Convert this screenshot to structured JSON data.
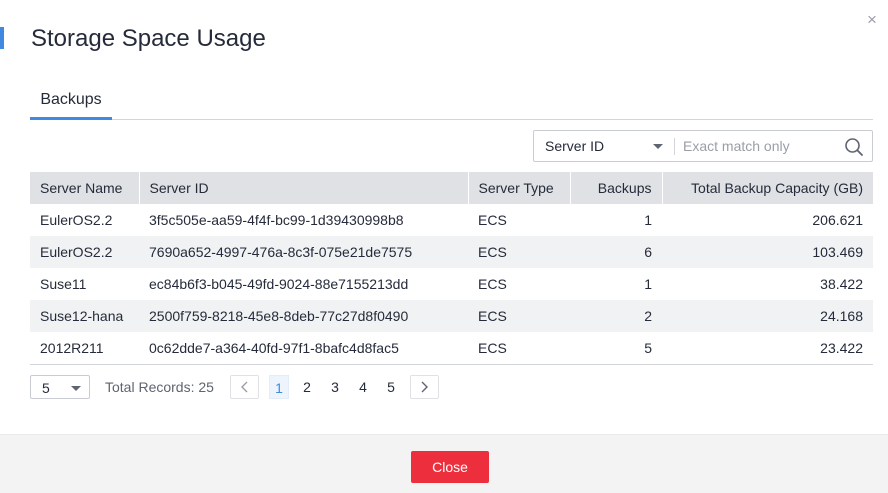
{
  "dialog": {
    "title": "Storage Space Usage",
    "close_glyph": "×"
  },
  "tabs": [
    {
      "label": "Backups",
      "active": true
    }
  ],
  "filter": {
    "field": "Server ID",
    "placeholder": "Exact match only",
    "value": ""
  },
  "table": {
    "columns": [
      "Server Name",
      "Server ID",
      "Server Type",
      "Backups",
      "Total Backup Capacity (GB)"
    ],
    "rows": [
      [
        "EulerOS2.2",
        "3f5c505e-aa59-4f4f-bc99-1d39430998b8",
        "ECS",
        "1",
        "206.621"
      ],
      [
        "EulerOS2.2",
        "7690a652-4997-476a-8c3f-075e21de7575",
        "ECS",
        "6",
        "103.469"
      ],
      [
        "Suse11",
        "ec84b6f3-b045-49fd-9024-88e7155213dd",
        "ECS",
        "1",
        "38.422"
      ],
      [
        "Suse12-hana",
        "2500f759-8218-45e8-8deb-77c27d8f0490",
        "ECS",
        "2",
        "24.168"
      ],
      [
        "2012R211",
        "0c62dde7-a364-40fd-97f1-8bafc4d8fac5",
        "ECS",
        "5",
        "23.422"
      ]
    ]
  },
  "pagination": {
    "page_size": "5",
    "total_label": "Total Records: 25",
    "pages": [
      "1",
      "2",
      "3",
      "4",
      "5"
    ],
    "current_page": "1"
  },
  "footer": {
    "close_label": "Close"
  },
  "colors": {
    "accent": "#3f8ae0",
    "danger": "#ed2f3d",
    "header_bg": "#dfe1e5",
    "stripe_bg": "#f1f2f3"
  },
  "icons": [
    "close-icon",
    "chevron-down-icon",
    "search-icon",
    "chevron-left-icon",
    "chevron-right-icon"
  ]
}
